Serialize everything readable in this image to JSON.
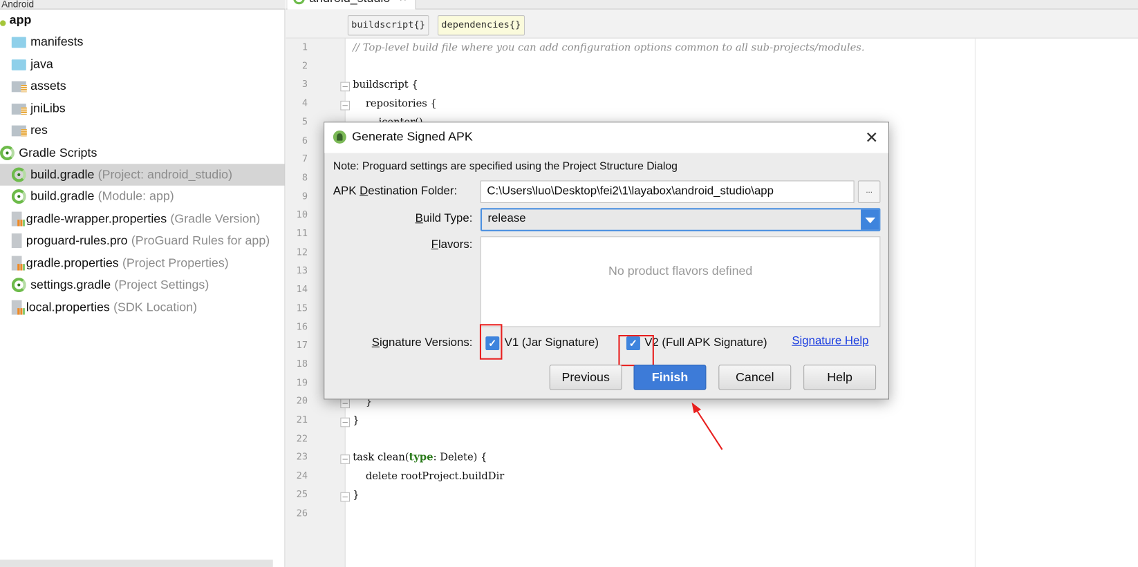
{
  "sidebar": {
    "header": "Android",
    "items": [
      {
        "label": "app",
        "hint": "",
        "icon": "module-icon"
      },
      {
        "label": "manifests",
        "hint": "",
        "icon": "folder-icon"
      },
      {
        "label": "java",
        "hint": "",
        "icon": "folder-icon"
      },
      {
        "label": "assets",
        "hint": "",
        "icon": "resource-folder-icon"
      },
      {
        "label": "jniLibs",
        "hint": "",
        "icon": "resource-folder-icon"
      },
      {
        "label": "res",
        "hint": "",
        "icon": "resource-folder-icon"
      },
      {
        "label": "Gradle Scripts",
        "hint": "",
        "icon": "gradle-icon"
      },
      {
        "label": "build.gradle",
        "hint": "(Project: android_studio)",
        "icon": "gradle-icon",
        "selected": true
      },
      {
        "label": "build.gradle",
        "hint": "(Module: app)",
        "icon": "gradle-icon"
      },
      {
        "label": "gradle-wrapper.properties",
        "hint": "(Gradle Version)",
        "icon": "properties-icon"
      },
      {
        "label": "proguard-rules.pro",
        "hint": "(ProGuard Rules for app)",
        "icon": "text-file-icon"
      },
      {
        "label": "gradle.properties",
        "hint": "(Project Properties)",
        "icon": "properties-icon"
      },
      {
        "label": "settings.gradle",
        "hint": "(Project Settings)",
        "icon": "gradle-icon"
      },
      {
        "label": "local.properties",
        "hint": "(SDK Location)",
        "icon": "properties-icon"
      }
    ]
  },
  "editor": {
    "tab": "android_studio",
    "tab_close": "×",
    "breadcrumbs": [
      "buildscript{}",
      "dependencies{}"
    ],
    "line_numbers": [
      "1",
      "2",
      "3",
      "4",
      "5",
      "6",
      "7",
      "8",
      "9",
      "10",
      "11",
      "12",
      "13",
      "14",
      "15",
      "16",
      "17",
      "18",
      "19",
      "20",
      "21",
      "22",
      "23",
      "24",
      "25",
      "26"
    ],
    "code": {
      "l1": "// Top-level build file where you can add configuration options common to all sub-projects/modules.",
      "l3": "buildscript {",
      "l4": "    repositories {",
      "l5": "        jcenter()",
      "l20": "    }",
      "l21": "}",
      "l23a": "task clean(",
      "l23kw": "type",
      "l23b": ": Delete) {",
      "l24": "    delete rootProject.buildDir",
      "l25": "}"
    }
  },
  "dialog": {
    "title": "Generate Signed APK",
    "close": "✕",
    "note": "Note: Proguard settings are specified using the Project Structure Dialog",
    "apk_label_pre": "APK ",
    "apk_label_u": "D",
    "apk_label_post": "estination Folder:",
    "apk_path": "C:\\Users\\luo\\Desktop\\fei2\\1\\layabox\\android_studio\\app",
    "browse": "...",
    "build_type_u": "B",
    "build_type_label": "uild Type:",
    "build_type_value": "release",
    "flavors_u": "F",
    "flavors_label": "lavors:",
    "flavors_empty": "No product flavors defined",
    "sig_u": "S",
    "sig_label": "ignature Versions:",
    "v1_label": "V1 (Jar Signature)",
    "v1_checked": true,
    "v2_label": "V2 (Full APK Signature)",
    "v2_checked": true,
    "signature_help": "Signature Help",
    "buttons": {
      "previous": "Previous",
      "finish": "Finish",
      "cancel": "Cancel",
      "help": "Help"
    }
  },
  "annotation_color": "#e8201f",
  "accent_color": "#3e84dd"
}
